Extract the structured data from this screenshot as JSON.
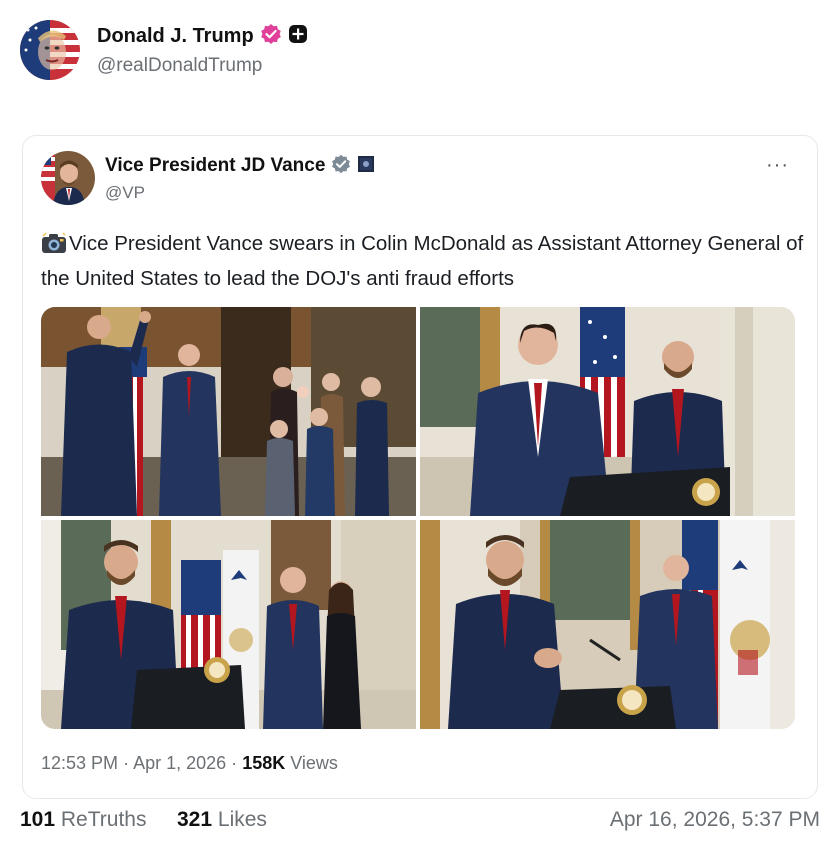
{
  "post": {
    "author_name": "Donald J. Trump",
    "author_handle": "@realDonaldTrump",
    "avatar_icon": "flag-face-avatar",
    "verified_icon": "verified-badge-icon",
    "verified_color": "#e0409a",
    "plus_icon": "plus-badge-icon"
  },
  "quote": {
    "author_name": "Vice President JD Vance",
    "author_handle": "@VP",
    "verified_icon": "verified-badge-icon",
    "verified_color": "#7d8a98",
    "gov_icon": "government-badge-icon",
    "more_label": "···",
    "text": "Vice President Vance swears in Colin McDonald as Assistant Attorney General of the United States to lead the DOJ's anti fraud efforts",
    "text_icon": "camera-icon",
    "photos": [
      {
        "icon": "swearing-in-photo"
      },
      {
        "icon": "podium-speech-photo"
      },
      {
        "icon": "vance-podium-photo"
      },
      {
        "icon": "vance-speaking-photo"
      }
    ],
    "time": "12:53 PM",
    "date": "Apr 1, 2026",
    "views_count": "158K",
    "views_label": "Views",
    "separator": "·"
  },
  "stats": {
    "retruths_count": "101",
    "retruths_label": "ReTruths",
    "likes_count": "321",
    "likes_label": "Likes",
    "post_timestamp": "Apr 16, 2026, 5:37 PM"
  },
  "colors": {
    "accent_pink": "#e0409a",
    "muted_text": "#6b7075",
    "suit_navy": "#1c2a4e",
    "tie_red": "#b3161e"
  }
}
